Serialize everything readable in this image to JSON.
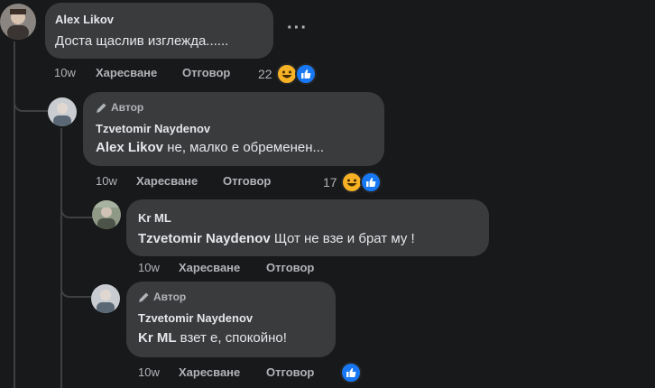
{
  "comments": [
    {
      "name": "Alex Likov",
      "text": "Доста щаслив изглежда......",
      "time": "10w",
      "like": "Харесване",
      "reply": "Отговор",
      "reactions_count": "22",
      "more_icon": "more-dots-icon"
    },
    {
      "author_badge": "Автор",
      "name": "Tzvetomir Naydenov",
      "mention": "Alex Likov",
      "text": " не, малко е обременен...",
      "time": "10w",
      "like": "Харесване",
      "reply": "Отговор",
      "reactions_count": "17"
    },
    {
      "name": "Kr ML",
      "mention": "Tzvetomir Naydenov",
      "text": " Щот не взе и брат му !",
      "time": "10w",
      "like": "Харесване",
      "reply": "Отговор"
    },
    {
      "author_badge": "Автор",
      "name": "Tzvetomir Naydenov",
      "mention": "Kr ML",
      "text": " взет е, спокойно!",
      "time": "10w",
      "like": "Харесване",
      "reply": "Отговор"
    }
  ],
  "colors": {
    "background": "#18191a",
    "bubble": "#3a3b3c",
    "text": "#e4e6eb",
    "muted": "#b0b3b8",
    "like_blue": "#1877f2",
    "haha_yellow": "#f7b125"
  }
}
